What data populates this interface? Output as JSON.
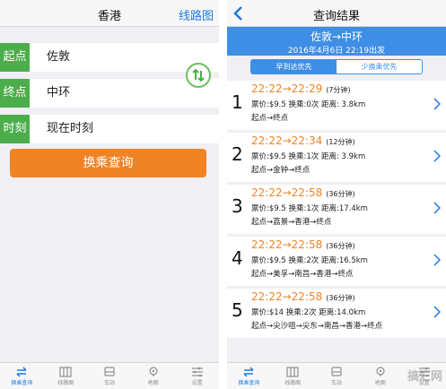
{
  "left": {
    "nav": {
      "title": "香港",
      "right_link": "线路图"
    },
    "form": {
      "from_label": "起点",
      "from_value": "佐敦",
      "to_label": "终点",
      "to_value": "中环",
      "time_label": "时刻",
      "time_value": "现在时刻"
    },
    "query_button": "换乘查询"
  },
  "right": {
    "nav": {
      "title": "查询结果"
    },
    "banner": {
      "route": "佐敦→中环",
      "time": "2016年4月6日 22:19出发"
    },
    "segment": {
      "option_a": "早到达优先",
      "option_b": "少换乘优先"
    },
    "results": [
      {
        "num": "1",
        "times": "22:22→22:29",
        "dur": "(7分钟)",
        "info": "票价:$9.5 换乘:0次 距离: 3.8km",
        "path": "起点→终点"
      },
      {
        "num": "2",
        "times": "22:22→22:34",
        "dur": "(12分钟)",
        "info": "票价:$9.5 换乘:1次 距离: 3.9km",
        "path": "起点→金钟→终点"
      },
      {
        "num": "3",
        "times": "22:22→22:58",
        "dur": "(36分钟)",
        "info": "票价:$9.5 换乘:1次 距离:17.4km",
        "path": "起点→荔景→香港→终点"
      },
      {
        "num": "4",
        "times": "22:22→22:58",
        "dur": "(36分钟)",
        "info": "票价:$9.5 换乘:2次 距离:16.5km",
        "path": "起点→美孚→南昌→香港→终点"
      },
      {
        "num": "5",
        "times": "22:22→22:58",
        "dur": "(36分钟)",
        "info": "票价:$14 换乘:2次 距离:14.0km",
        "path": "起点→尖沙咀→尖东→南昌→香港→终点"
      }
    ]
  },
  "tabbar": [
    {
      "label": "换乘查询",
      "icon": "transfer-icon"
    },
    {
      "label": "线路图",
      "icon": "map-book-icon"
    },
    {
      "label": "车站",
      "icon": "station-icon"
    },
    {
      "label": "地图",
      "icon": "location-pin-icon"
    },
    {
      "label": "设置",
      "icon": "settings-sliders-icon"
    }
  ],
  "watermark": "搞汇网",
  "colors": {
    "accent_blue": "#3f8ee5",
    "green_tag": "#4bae4b",
    "orange": "#f08324"
  }
}
